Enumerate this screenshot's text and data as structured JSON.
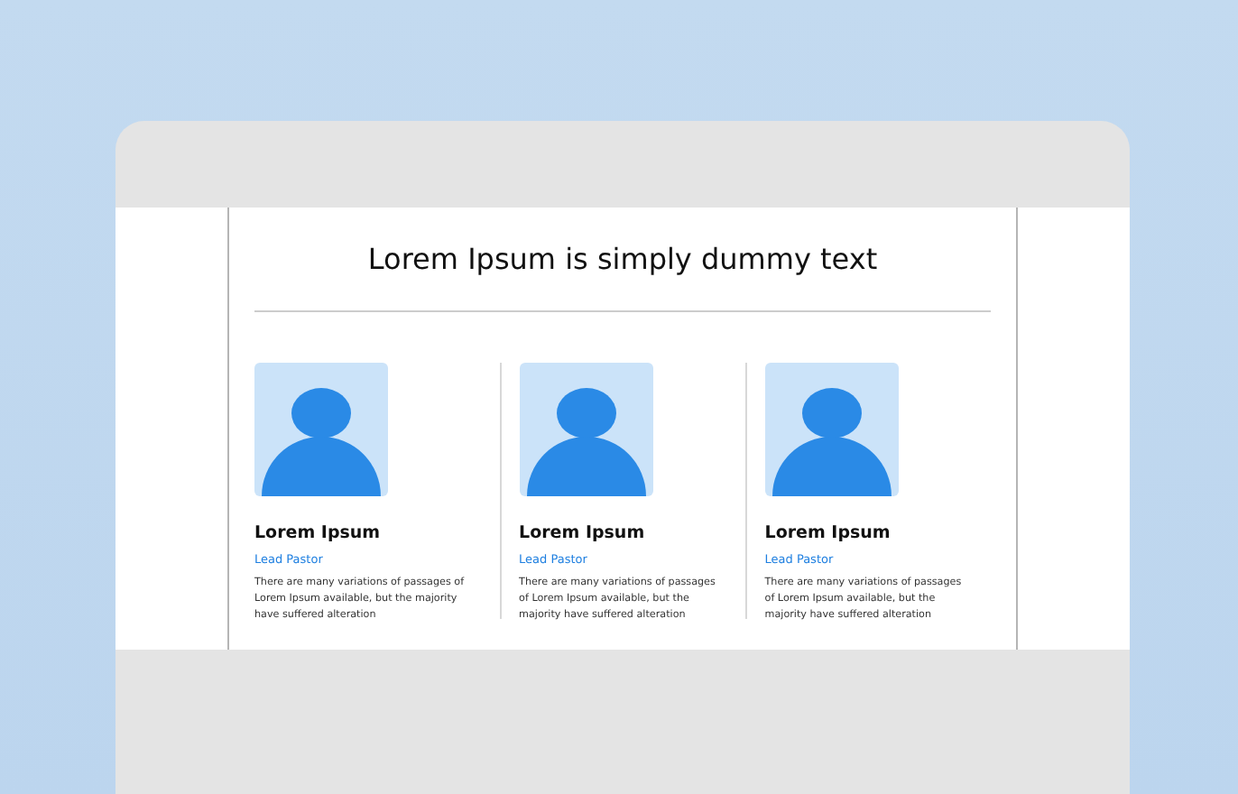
{
  "title": "Lorem Ipsum is simply dummy text",
  "members": [
    {
      "name": "Lorem Ipsum",
      "role": "Lead Pastor",
      "bio": "There are many variations of passages of Lorem Ipsum available, but the majority have suffered alteration"
    },
    {
      "name": "Lorem Ipsum",
      "role": "Lead Pastor",
      "bio": "There are many variations of passages of Lorem Ipsum available, but the majority have suffered alteration"
    },
    {
      "name": "Lorem Ipsum",
      "role": "Lead Pastor",
      "bio": "There are many variations of passages of Lorem Ipsum available, but the majority have suffered alteration"
    }
  ]
}
